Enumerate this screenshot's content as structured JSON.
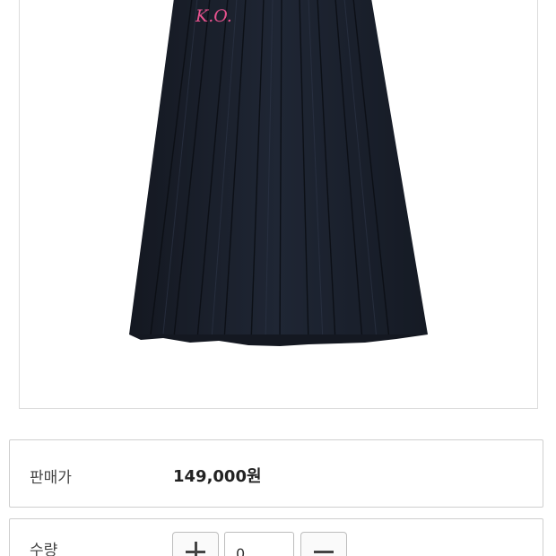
{
  "product": {
    "image_alt": "pleated navy skirt",
    "logo_text": "K.O.",
    "logo_color": "#e8528f",
    "skirt_color": "#1c2230"
  },
  "price_section": {
    "label": "판매가",
    "value": "149,000원"
  },
  "quantity_section": {
    "label": "수량",
    "value": "0",
    "plus_icon": "plus-icon",
    "minus_icon": "minus-icon"
  }
}
